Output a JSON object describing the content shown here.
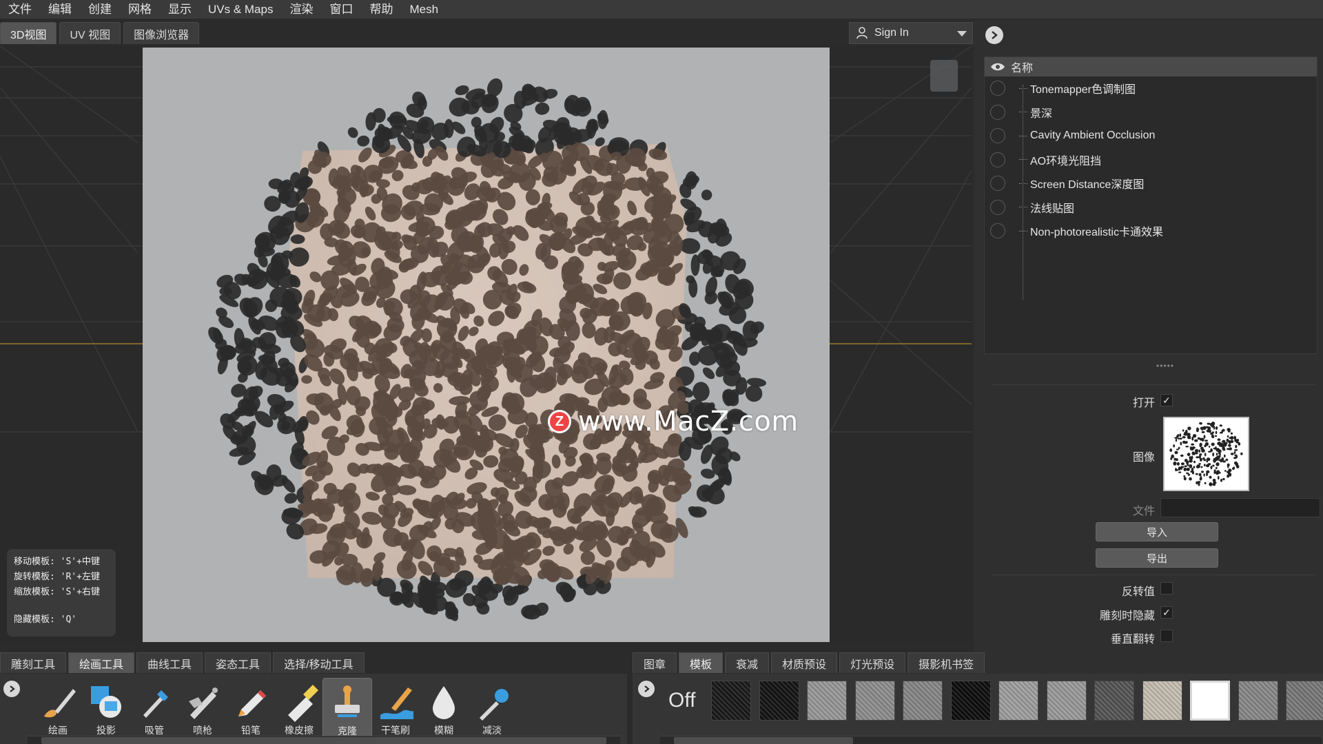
{
  "menubar": {
    "items": [
      "文件",
      "编辑",
      "创建",
      "网格",
      "显示",
      "UVs & Maps",
      "渲染",
      "窗口",
      "帮助",
      "Mesh"
    ]
  },
  "view_tabs": [
    {
      "label": "3D视图",
      "active": true
    },
    {
      "label": "UV 视图",
      "active": false
    },
    {
      "label": "图像浏览器",
      "active": false
    }
  ],
  "signin": {
    "label": "Sign In"
  },
  "watermark": {
    "logo": "Z",
    "text": "www.MacZ.com"
  },
  "hints": {
    "move": "移动模板: 'S'+中键",
    "rotate": "旋转模板: 'R'+左键",
    "scale": "缩放模板: 'S'+右键",
    "hide": "隐藏模板: 'Q'"
  },
  "layers": {
    "header": "名称",
    "items": [
      "Tonemapper色调制图",
      "景深",
      "Cavity Ambient Occlusion",
      "AO环境光阻挡",
      "Screen Distance深度图",
      "法线贴图",
      "Non-photorealistic卡通效果"
    ]
  },
  "properties": {
    "open_label": "打开",
    "open_checked": true,
    "image_label": "图像",
    "file_label": "文件",
    "import_label": "导入",
    "export_label": "导出",
    "invert_label": "反转值",
    "invert_checked": false,
    "hide_on_sculpt_label": "雕刻时隐藏",
    "hide_on_sculpt_checked": true,
    "flip_vertical_label": "垂直翻转",
    "flip_vertical_checked": false,
    "check_mark": "✓"
  },
  "tool_tabs": [
    {
      "label": "雕刻工具",
      "active": false
    },
    {
      "label": "绘画工具",
      "active": true
    },
    {
      "label": "曲线工具",
      "active": false
    },
    {
      "label": "姿态工具",
      "active": false
    },
    {
      "label": "选择/移动工具",
      "active": false
    }
  ],
  "tray_tabs": [
    {
      "label": "图章",
      "active": false
    },
    {
      "label": "模板",
      "active": true
    },
    {
      "label": "衰减",
      "active": false
    },
    {
      "label": "材质预设",
      "active": false
    },
    {
      "label": "灯光预设",
      "active": false
    },
    {
      "label": "摄影机书签",
      "active": false
    }
  ],
  "tools": [
    {
      "label": "绘画",
      "icon": "paint-brush-icon",
      "active": false
    },
    {
      "label": "投影",
      "icon": "projection-icon",
      "active": false
    },
    {
      "label": "吸管",
      "icon": "eyedropper-icon",
      "active": false
    },
    {
      "label": "喷枪",
      "icon": "airbrush-icon",
      "active": false
    },
    {
      "label": "铅笔",
      "icon": "pencil-icon",
      "active": false
    },
    {
      "label": "橡皮擦",
      "icon": "eraser-icon",
      "active": false
    },
    {
      "label": "克隆",
      "icon": "clone-stamp-icon",
      "active": true
    },
    {
      "label": "干笔刷",
      "icon": "dry-brush-icon",
      "active": false
    },
    {
      "label": "模糊",
      "icon": "blur-drop-icon",
      "active": false
    },
    {
      "label": "减淡",
      "icon": "dodge-icon",
      "active": false
    }
  ],
  "stencil_off_label": "Off",
  "stencils_selected_index": 10,
  "colors": {
    "accent_orange": "#f0a040",
    "tool_blue": "#3a9de0",
    "selected_border": "#d8d8d8"
  }
}
